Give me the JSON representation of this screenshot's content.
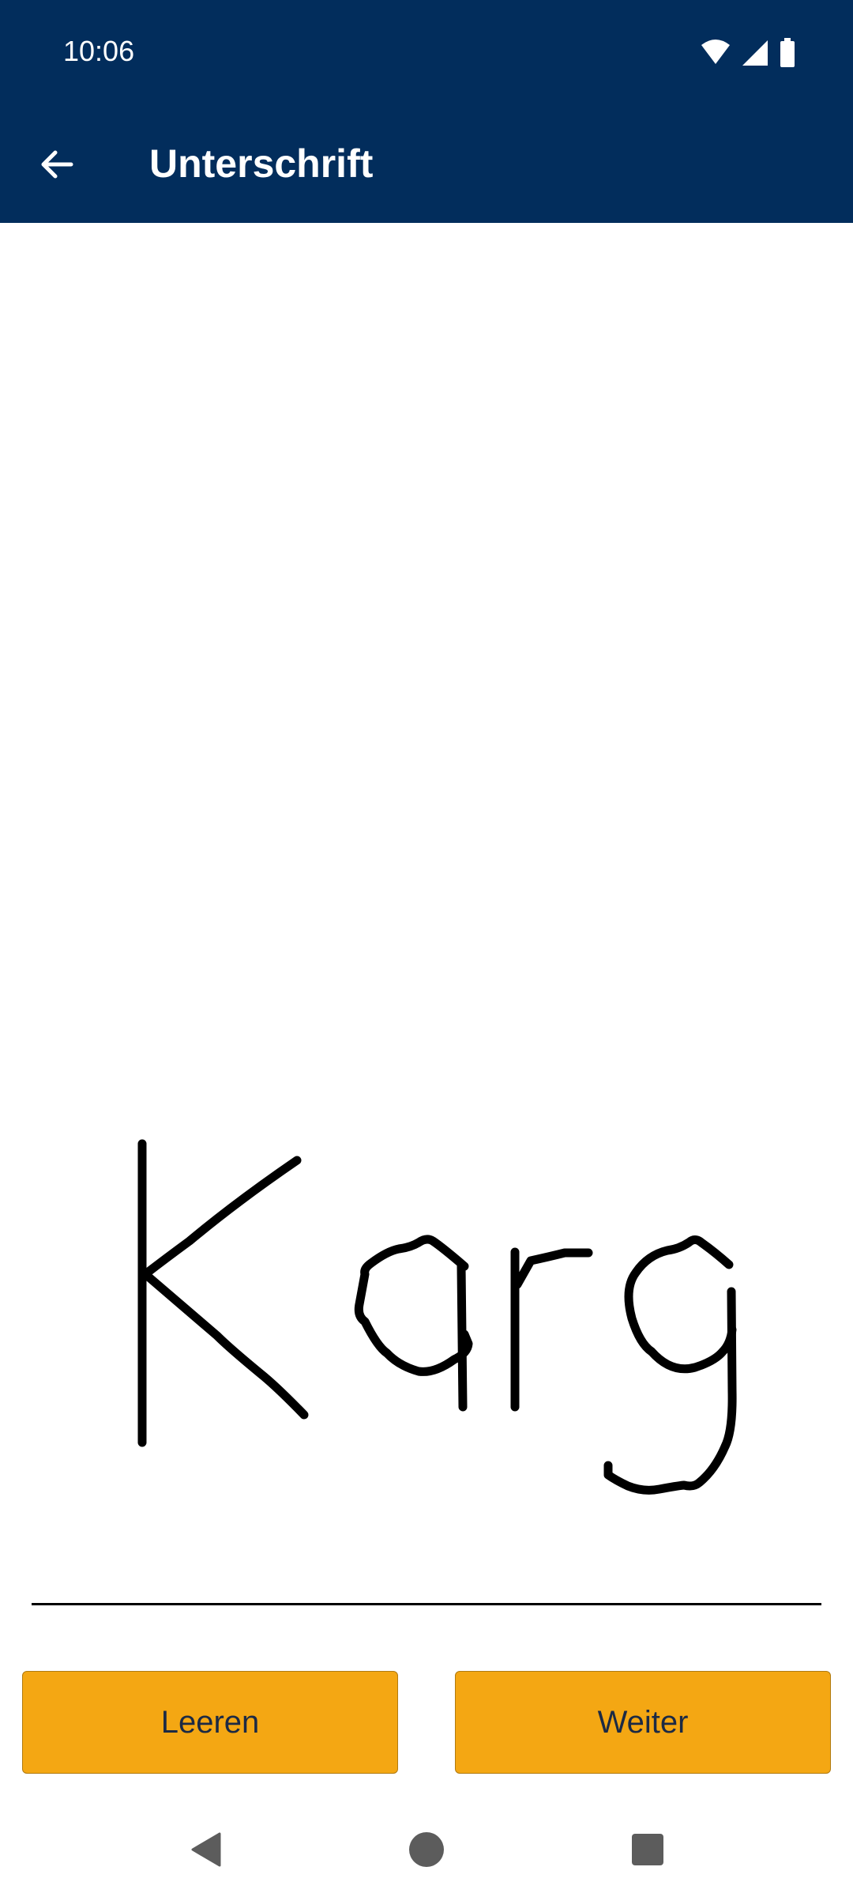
{
  "status_bar": {
    "time": "10:06",
    "icons": [
      "wifi-icon",
      "signal-icon",
      "battery-icon"
    ]
  },
  "app_bar": {
    "title": "Unterschrift",
    "back_icon": "arrow-back-icon"
  },
  "signature": {
    "text": "Karg"
  },
  "actions": {
    "clear_label": "Leeren",
    "next_label": "Weiter"
  },
  "nav_bar": {
    "icons": [
      "back-triangle-icon",
      "home-circle-icon",
      "recents-square-icon"
    ]
  },
  "colors": {
    "primary": "#022d5c",
    "accent": "#f4a713",
    "button_text": "#1c2a44"
  }
}
